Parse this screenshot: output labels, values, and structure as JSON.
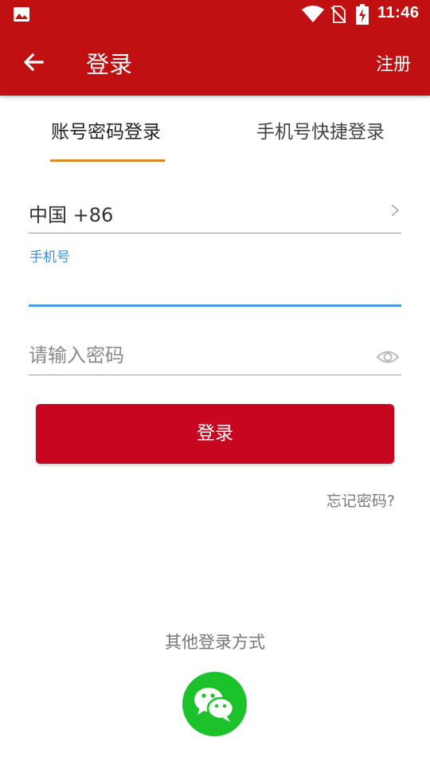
{
  "status_bar": {
    "time": "11:46",
    "icons": [
      "image-icon",
      "wifi-icon",
      "no-sim-icon",
      "battery-charging-icon"
    ]
  },
  "app_bar": {
    "back_icon": "arrow-left-icon",
    "title": "登录",
    "register_label": "注册",
    "background": "#c01012"
  },
  "tabs": [
    {
      "label": "账号密码登录",
      "active": true
    },
    {
      "label": "手机号快捷登录",
      "active": false
    }
  ],
  "tab_indicator_color": "#d98a1e",
  "form": {
    "country_code": "中国 +86",
    "phone_label": "手机号",
    "phone_value": "",
    "password_placeholder": "请输入密码",
    "password_value": "",
    "focus_color": "#4a9be4"
  },
  "login_button": {
    "label": "登录",
    "color": "#c8061f"
  },
  "forgot_password": "忘记密码?",
  "other_login": {
    "title": "其他登录方式",
    "wechat_icon": "wechat-icon",
    "wechat_color": "#1bc22a"
  }
}
